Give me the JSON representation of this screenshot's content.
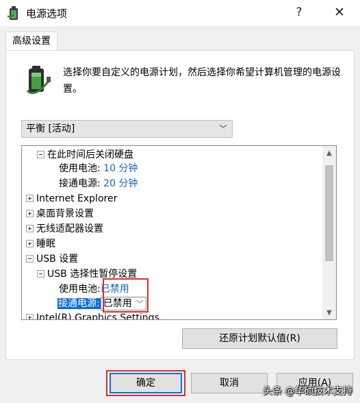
{
  "window": {
    "title": "电源选项",
    "help_symbol": "?",
    "close_symbol": "✕",
    "icon": "power-battery-icon"
  },
  "tabs": [
    {
      "label": "高级设置",
      "active": true
    }
  ],
  "header": {
    "description": "选择你要自定义的电源计划，然后选择你希望计算机管理的电源设置。",
    "icon": "battery-plug-icon"
  },
  "plan_select": {
    "value": "平衡 [活动]"
  },
  "tree": {
    "items": [
      {
        "label": "在此时间后关闭硬盘",
        "expanded": true,
        "level": 1
      },
      {
        "label": "使用电池:",
        "value": "10 分钟",
        "level": 2
      },
      {
        "label": "接通电源:",
        "value": "20 分钟",
        "level": 2
      },
      {
        "label": "Internet Explorer",
        "expanded": false,
        "level": 0
      },
      {
        "label": "桌面背景设置",
        "expanded": false,
        "level": 0
      },
      {
        "label": "无线适配器设置",
        "expanded": false,
        "level": 0
      },
      {
        "label": "睡眠",
        "expanded": false,
        "level": 0
      },
      {
        "label": "USB 设置",
        "expanded": true,
        "level": 0
      },
      {
        "label": "USB 选择性暂停设置",
        "expanded": true,
        "level": 1
      },
      {
        "label": "使用电池:",
        "value": "已禁用",
        "level": 2
      },
      {
        "label": "接通电源:",
        "value": "已禁用",
        "level": 2,
        "selected": true,
        "editing": true
      },
      {
        "label": "Intel(R) Graphics Settings",
        "expanded": false,
        "level": 0
      }
    ]
  },
  "buttons": {
    "restore_defaults": "还原计划默认值(R)",
    "ok": "确定",
    "cancel": "取消",
    "apply": "应用(A)"
  },
  "watermark": "头条 @华硕技术支持",
  "colors": {
    "link_value": "#1565c0",
    "selection": "#0a6ed1",
    "highlight_box": "#d32f2f",
    "accent": "#0078d7"
  }
}
